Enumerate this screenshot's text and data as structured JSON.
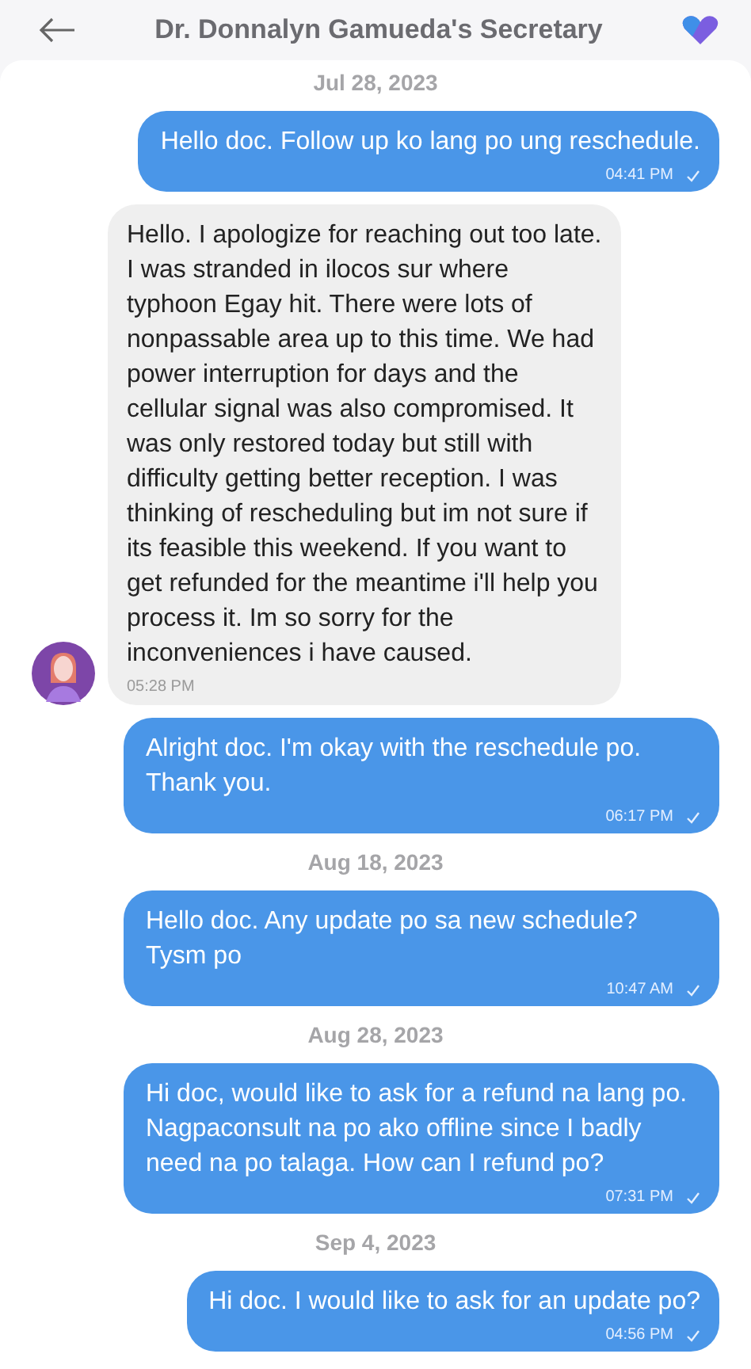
{
  "header": {
    "title": "Dr. Donnalyn Gamueda's Secretary"
  },
  "messages": [
    {
      "kind": "date",
      "text": "Jul 28, 2023"
    },
    {
      "kind": "sent",
      "text": "Hello doc. Follow up ko lang po ung reschedule.",
      "time": "04:41 PM"
    },
    {
      "kind": "received",
      "text": "Hello. I apologize for reaching out too late. I was stranded in ilocos sur where typhoon Egay hit. There were lots of nonpassable area up to this time. We had power interruption for days and the cellular signal was also compromised. It was only restored today but still with difficulty getting better reception. I was thinking of rescheduling but im not sure if its feasible this weekend. If you want to get refunded for the meantime i'll help you process it. Im so sorry for the inconveniences i have caused.",
      "time": "05:28 PM"
    },
    {
      "kind": "sent",
      "text": "Alright doc. I'm okay with the reschedule po. Thank you.",
      "time": "06:17 PM"
    },
    {
      "kind": "date",
      "text": "Aug 18, 2023"
    },
    {
      "kind": "sent",
      "text": "Hello doc. Any update po sa new schedule? Tysm po",
      "time": "10:47 AM"
    },
    {
      "kind": "date",
      "text": "Aug 28, 2023"
    },
    {
      "kind": "sent",
      "text": "Hi doc, would like to ask for a refund na lang po. Nagpaconsult na po ako offline since I badly need na po talaga. How can I refund po?",
      "time": "07:31 PM"
    },
    {
      "kind": "date",
      "text": "Sep 4, 2023"
    },
    {
      "kind": "sent",
      "text": "Hi doc. I would like to ask for an update po?",
      "time": "04:56 PM"
    }
  ]
}
